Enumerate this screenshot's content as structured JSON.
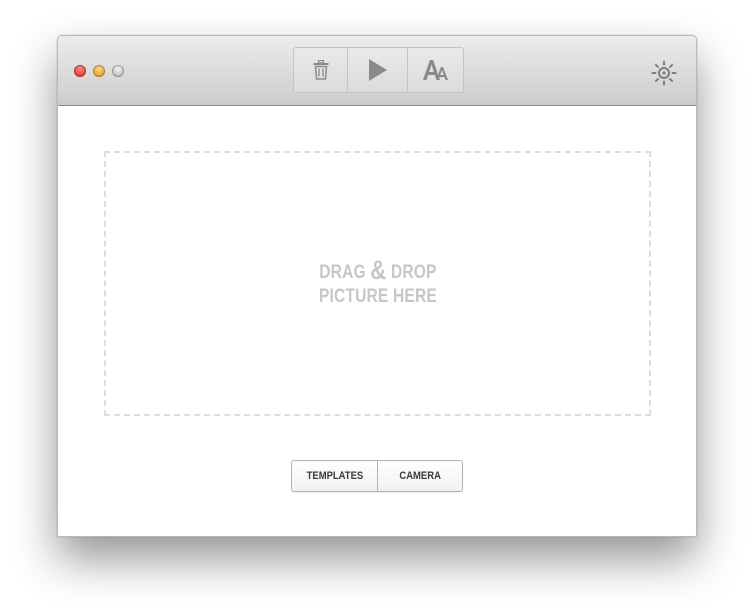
{
  "window": {
    "traffic_lights": [
      "close",
      "minimize",
      "zoom"
    ]
  },
  "toolbar": {
    "buttons": [
      {
        "icon": "trash-icon"
      },
      {
        "icon": "play-icon"
      },
      {
        "icon": "font-size-icon"
      }
    ],
    "settings_icon": "sun-gear-icon"
  },
  "dropzone": {
    "line1_before": "DRAG ",
    "line1_amp": "&",
    "line1_after": " DROP",
    "line2": "PICTURE HERE"
  },
  "source_buttons": {
    "templates_label": "TEMPLATES",
    "camera_label": "CAMERA"
  },
  "colors": {
    "dropzone_text": "#c6c6c6",
    "dropzone_border": "#dddddd"
  }
}
